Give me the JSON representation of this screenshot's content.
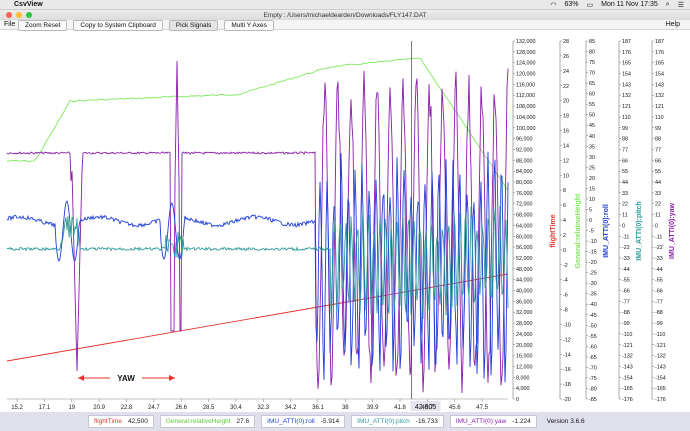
{
  "menubar_mac": {
    "app_name": "CsvView",
    "battery": "63%",
    "clock": "Mon 11 Nov  17:35"
  },
  "window": {
    "title": "Empty : /Users/michaeldearden/Downloads/FLY147.DAT"
  },
  "menu": {
    "file": "File",
    "help": "Help"
  },
  "toolbar": {
    "zoom_reset": "Zoom Reset",
    "copy": "Copy to System Clipboard",
    "pick_signals": "Pick Signals",
    "multi_y": "Multi Y Axes"
  },
  "colors": {
    "flightTime": "#e8342c",
    "height": "#7ee85a",
    "roll": "#1f3fd8",
    "pitch": "#2e9a98",
    "yaw": "#8a1ea8",
    "status_bg": "#dfe0ec"
  },
  "chart_data": {
    "type": "line",
    "x_ticks": [
      "15.2",
      "17.1",
      "19",
      "20.9",
      "22.8",
      "24.7",
      "26.6",
      "28.5",
      "30.4",
      "32.3",
      "34.2",
      "36.1",
      "38",
      "39.9",
      "41.8",
      "43.7",
      "45.6",
      "47.5"
    ],
    "cursor_x_label": "42.605",
    "annotation": "YAW",
    "axes": [
      {
        "name": "flightTime",
        "ticks": [
          "132,000",
          "128,000",
          "124,000",
          "120,000",
          "116,000",
          "112,000",
          "108,000",
          "104,000",
          "100,000",
          "96,000",
          "92,000",
          "88,000",
          "84,000",
          "80,000",
          "76,000",
          "72,000",
          "68,000",
          "64,000",
          "60,000",
          "56,000",
          "52,000",
          "48,000",
          "44,000",
          "40,000",
          "36,000",
          "32,000",
          "28,000",
          "24,000",
          "20,000",
          "16,000",
          "12,000",
          "8,000",
          "4,000",
          "0"
        ]
      },
      {
        "name": "General:relativeHeight",
        "ticks": [
          "28",
          "26",
          "24",
          "22",
          "20",
          "18",
          "16",
          "14",
          "12",
          "10",
          "8",
          "6",
          "4",
          "2",
          "0",
          "-2",
          "-4",
          "-6",
          "-8",
          "-10",
          "-12",
          "-14",
          "-16",
          "-18",
          "-20"
        ]
      },
      {
        "name": "IMU_ATTI(0):roll",
        "ticks": [
          "85",
          "80",
          "75",
          "70",
          "65",
          "60",
          "55",
          "50",
          "45",
          "40",
          "35",
          "30",
          "25",
          "20",
          "15",
          "10",
          "5",
          "0",
          "-5",
          "-10",
          "-15",
          "-20",
          "-25",
          "-30",
          "-35",
          "-40",
          "-45",
          "-50",
          "-55",
          "-60",
          "-65",
          "-70",
          "-75",
          "-80",
          "-85"
        ]
      },
      {
        "name": "IMU_ATTI(0):pitch",
        "ticks": [
          "187",
          "176",
          "165",
          "154",
          "143",
          "132",
          "121",
          "110",
          "99",
          "88",
          "77",
          "66",
          "55",
          "44",
          "33",
          "22",
          "11",
          "0",
          "-11",
          "-22",
          "-33",
          "-44",
          "-55",
          "-66",
          "-77",
          "-88",
          "-99",
          "-110",
          "-121",
          "-132",
          "-143",
          "-154",
          "-165",
          "-176"
        ]
      },
      {
        "name": "IMU_ATTI(0):yaw",
        "ticks": [
          "187",
          "176",
          "165",
          "154",
          "143",
          "132",
          "121",
          "110",
          "99",
          "88",
          "77",
          "66",
          "55",
          "44",
          "33",
          "22",
          "11",
          "0",
          "-11",
          "-22",
          "-33",
          "-44",
          "-55",
          "-66",
          "-77",
          "-88",
          "-99",
          "-110",
          "-121",
          "-132",
          "-143",
          "-154",
          "-165",
          "-176"
        ]
      }
    ]
  },
  "status": {
    "flightTime_label": "flightTime",
    "flightTime_value": "42,500",
    "height_label": "General:relativeHeight",
    "height_value": "27.6",
    "roll_label": "IMU_ATTI(0):roll",
    "roll_value": "-5.914",
    "pitch_label": "IMU_ATTI(0):pitch",
    "pitch_value": "-16.733",
    "yaw_label": "IMU_ATTI(0):yaw",
    "yaw_value": "-1.224",
    "version": "Version 3.6.6"
  }
}
